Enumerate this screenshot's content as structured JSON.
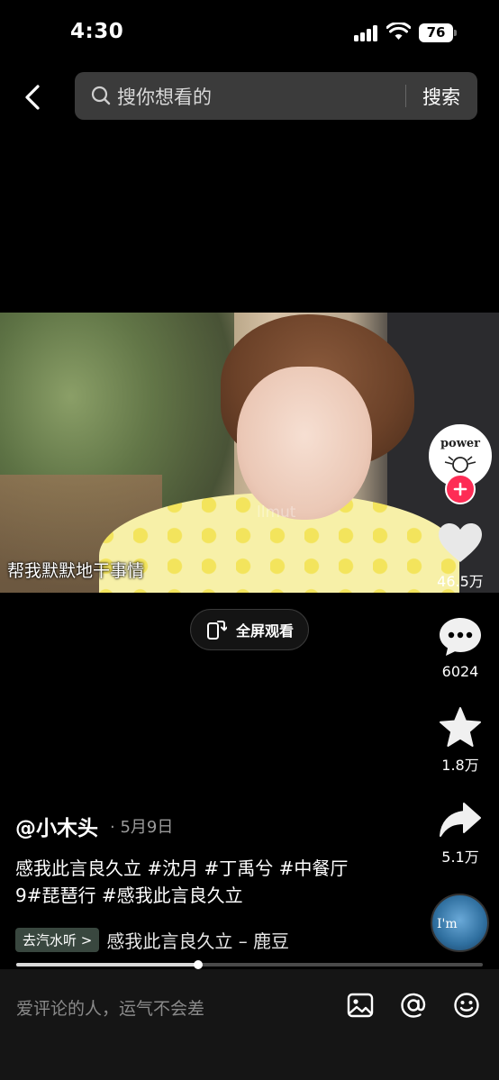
{
  "status_bar": {
    "time": "4:30",
    "battery": "76"
  },
  "search": {
    "placeholder": "搜你想看的",
    "button_label": "搜索"
  },
  "video": {
    "subtitle": "帮我默默地干事情",
    "watermark": "llmut"
  },
  "fullscreen": {
    "label": "全屏观看"
  },
  "author": {
    "avatar_text": "power"
  },
  "actions": {
    "like_count": "46.5万",
    "comment_count": "6024",
    "favorite_count": "1.8万",
    "share_count": "5.1万"
  },
  "music_disc": {
    "text": "I'm"
  },
  "post": {
    "username": "@小木头",
    "date": "· 5月9日",
    "caption_line1": "感我此言良久立 #沈月 #丁禹兮 #中餐厅",
    "caption_line2": "9#琵琶行 #感我此言良久立"
  },
  "music": {
    "tag": "去汽水听 >",
    "title": "感我此言良久立 – 鹿豆"
  },
  "progress": {
    "fraction": 0.39
  },
  "comment": {
    "placeholder": "爱评论的人，运气不会差"
  },
  "colors": {
    "accent": "#fe2c55",
    "background": "#000000",
    "music_tag": "#39473f"
  }
}
